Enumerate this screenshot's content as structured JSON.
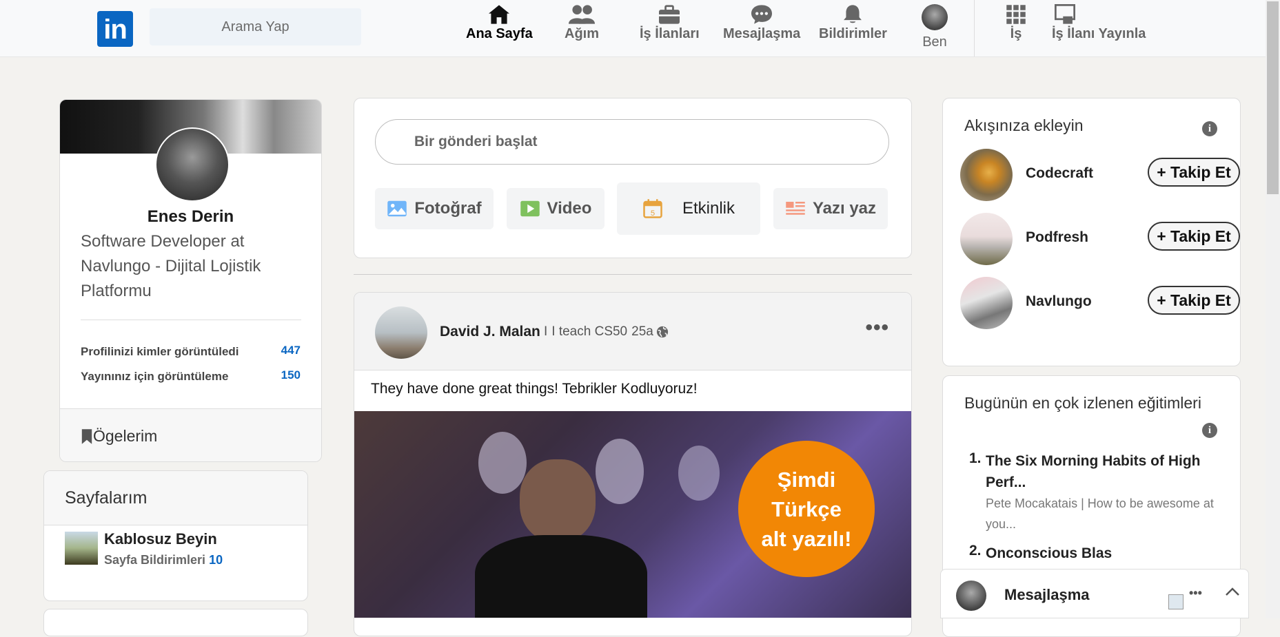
{
  "nav": {
    "search_placeholder": "Arama Yap",
    "items": [
      {
        "label": "Ana Sayfa",
        "icon": "home-icon"
      },
      {
        "label": "Ağım",
        "icon": "network-icon"
      },
      {
        "label": "İş İlanları",
        "icon": "briefcase-icon"
      },
      {
        "label": "Mesajlaşma",
        "icon": "messaging-icon"
      },
      {
        "label": "Bildirimler",
        "icon": "bell-icon"
      },
      {
        "label": "Ben",
        "icon": "avatar"
      },
      {
        "label": "İş",
        "icon": "grid-icon"
      },
      {
        "label": "İş İlanı Yayınla",
        "icon": "post-job-icon"
      }
    ]
  },
  "profile": {
    "name": "Enes Derin",
    "headline": "Software Developer at Navlungo - Dijital Lojistik Platformu",
    "stats": [
      {
        "label": "Profilinizi kimler görüntüledi",
        "value": "447"
      },
      {
        "label": "Yayınınız için görüntüleme",
        "value": "150"
      }
    ],
    "items_label": "Ögelerim"
  },
  "pages": {
    "title": "Sayfalarım",
    "page_name": "Kablosuz Beyin",
    "notif_label": "Sayfa Bildirimleri",
    "notif_count": "10"
  },
  "composer": {
    "placeholder": "Bir gönderi başlat",
    "actions": [
      "Fotoğraf",
      "Video",
      "Etkinlik",
      "Yazı yaz"
    ],
    "calendar_day": "5"
  },
  "post": {
    "author": "David J. Malan",
    "subtitle": "I teach CS50",
    "time": "25a",
    "text": "They have done great things! Tebrikler Kodluyoruz!",
    "badge_lines": [
      "Şimdi",
      "Türkçe",
      "alt yazılı!"
    ]
  },
  "follow": {
    "title": "Akışınıza ekleyin",
    "button_label": "+ Takip Et",
    "companies": [
      "Codecraft",
      "Podfresh",
      "Navlungo"
    ]
  },
  "courses": {
    "title": "Bugünün en çok izlenen eğitimleri",
    "items": [
      {
        "num": "1.",
        "title_line1": "The Six Morning Habits of High",
        "title_line2": "Perf...",
        "sub_line1": "Pete Mocakatais | How to be awesome at",
        "sub_line2": "you..."
      },
      {
        "num": "2.",
        "title_line1": "Onconscious Blas"
      }
    ]
  },
  "messaging": {
    "label": "Mesajlaşma"
  },
  "colors": {
    "brand": "#0a66c2",
    "badge": "#f28705"
  }
}
